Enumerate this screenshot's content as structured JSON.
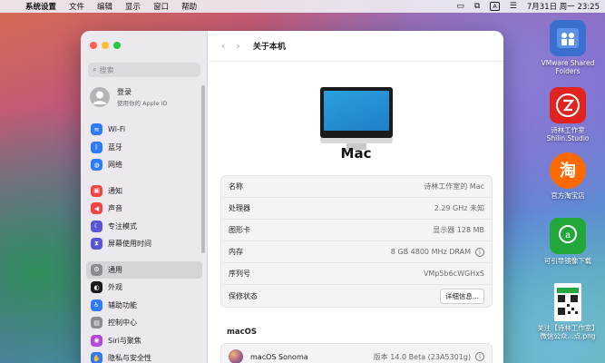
{
  "menubar": {
    "apple": "",
    "app_name": "系统设置",
    "items": [
      "文件",
      "编辑",
      "显示",
      "窗口",
      "帮助"
    ],
    "input_indicator": "A",
    "datetime": "7月31日 周一  23:25"
  },
  "desktop_icons": [
    {
      "label": "VMware Shared Folders",
      "icon": "shared-folder-icon",
      "color": "#3a6fd0"
    },
    {
      "label": "诗林工作室 Shilin.Studio",
      "icon": "shilin-studio-icon",
      "color": "#e0231f"
    },
    {
      "label": "官方淘宝店",
      "icon": "taobao-icon",
      "color": "#ff6a00",
      "glyph": "淘"
    },
    {
      "label": "可引导镜像下载",
      "icon": "coolaa-icon",
      "color": "#22a83a"
    },
    {
      "label": "关注【诗林工作室】微信公众...点.png",
      "icon": "qr-code-icon",
      "color": "#ffffff"
    }
  ],
  "window": {
    "search_placeholder": "搜索",
    "account": {
      "title": "登录",
      "subtitle": "使用你的 Apple ID"
    },
    "sidebar_items": [
      {
        "label": "Wi-Fi",
        "icon": "wifi-icon",
        "color": "#2f7bf6",
        "glyph": "≋"
      },
      {
        "label": "蓝牙",
        "icon": "bluetooth-icon",
        "color": "#2f7bf6",
        "glyph": "ᛒ"
      },
      {
        "label": "网络",
        "icon": "globe-icon",
        "color": "#2f7bf6",
        "glyph": "◍"
      },
      {
        "label": "通知",
        "icon": "notifications-icon",
        "color": "#f04545",
        "glyph": "▣"
      },
      {
        "label": "声音",
        "icon": "speaker-icon",
        "color": "#f04545",
        "glyph": "◀"
      },
      {
        "label": "专注模式",
        "icon": "moon-icon",
        "color": "#5b55d6",
        "glyph": "☾"
      },
      {
        "label": "屏幕使用时间",
        "icon": "hourglass-icon",
        "color": "#5b55d6",
        "glyph": "⧗"
      },
      {
        "label": "通用",
        "icon": "gear-icon",
        "color": "#8e8c92",
        "glyph": "⚙"
      },
      {
        "label": "外观",
        "icon": "appearance-icon",
        "color": "#1b1b1b",
        "glyph": "◐"
      },
      {
        "label": "辅助功能",
        "icon": "accessibility-icon",
        "color": "#2f7bf6",
        "glyph": "♿"
      },
      {
        "label": "控制中心",
        "icon": "control-center-icon",
        "color": "#8e8c92",
        "glyph": "▤"
      },
      {
        "label": "Siri与聚焦",
        "icon": "siri-icon",
        "color": "#b14bd8",
        "glyph": "◉"
      },
      {
        "label": "隐私与安全性",
        "icon": "hand-icon",
        "color": "#2f7bf6",
        "glyph": "✋"
      }
    ],
    "toolbar_title": "关于本机",
    "device_title": "Mac",
    "info_rows": [
      {
        "key": "名称",
        "value": "诗林工作室的 Mac"
      },
      {
        "key": "处理器",
        "value": "2.29 GHz 未知"
      },
      {
        "key": "图形卡",
        "value": "显示器 128 MB"
      },
      {
        "key": "内存",
        "value": "8 GB 4800 MHz DRAM"
      },
      {
        "key": "序列号",
        "value": "VMp5b6cWGHxS"
      },
      {
        "key": "保修状态",
        "value": "详细信息..."
      }
    ],
    "os_section_title": "macOS",
    "os_name": "macOS Sonoma",
    "os_version": "版本 14.0 Beta (23A5301g)"
  }
}
